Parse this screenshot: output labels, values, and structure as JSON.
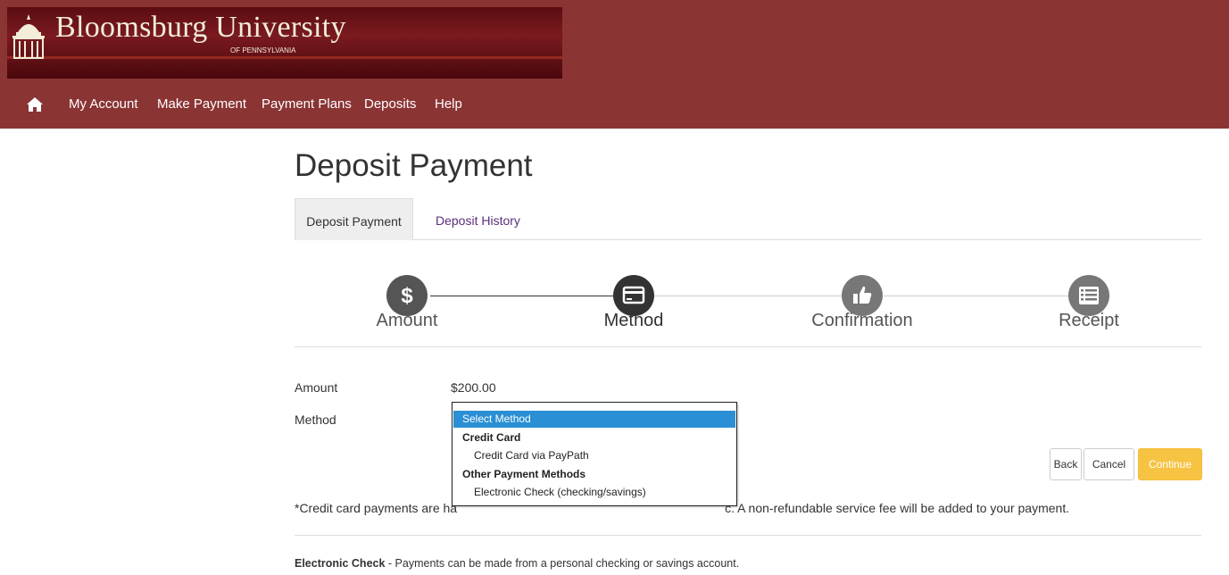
{
  "header": {
    "university_name": "Bloomsburg University",
    "university_subtitle": "OF PENNSYLVANIA"
  },
  "nav": {
    "home_icon": "home-icon",
    "items": [
      "My Account",
      "Make Payment",
      "Payment Plans",
      "Deposits",
      "Help"
    ]
  },
  "page": {
    "title": "Deposit Payment",
    "tabs": [
      {
        "label": "Deposit Payment",
        "active": true
      },
      {
        "label": "Deposit History",
        "active": false
      }
    ]
  },
  "steps": [
    {
      "label": "Amount",
      "icon": "dollar-icon",
      "state": "done"
    },
    {
      "label": "Method",
      "icon": "credit-card-icon",
      "state": "current"
    },
    {
      "label": "Confirmation",
      "icon": "thumbs-up-icon",
      "state": "pending"
    },
    {
      "label": "Receipt",
      "icon": "list-icon",
      "state": "pending"
    }
  ],
  "form": {
    "amount_label": "Amount",
    "amount_value": "$200.00",
    "method_label": "Method",
    "method_dropdown": {
      "selected": "Select Method",
      "options": [
        {
          "type": "option",
          "label": "Select Method",
          "selected": true
        },
        {
          "type": "group",
          "label": "Credit Card"
        },
        {
          "type": "option",
          "label": "Credit Card via PayPath"
        },
        {
          "type": "group",
          "label": "Other Payment Methods"
        },
        {
          "type": "option",
          "label": "Electronic Check (checking/savings)"
        }
      ]
    }
  },
  "buttons": {
    "back": "Back",
    "cancel": "Cancel",
    "continue": "Continue"
  },
  "notes": {
    "credit_card_visible_before": "*Credit card payments are ha",
    "credit_card_visible_after": "c. A non-refundable service fee will be added to your payment.",
    "electronic_check_title": "Electronic Check",
    "electronic_check_text": " - Payments can be made from a personal checking or savings account."
  },
  "colors": {
    "header_bg": "#8b3434",
    "accent_button": "#f6c343",
    "selected_option": "#2a8fd4",
    "tab_link": "#5b2e7a",
    "step_done": "#555555",
    "step_current": "#333333",
    "step_pending": "#777777"
  }
}
